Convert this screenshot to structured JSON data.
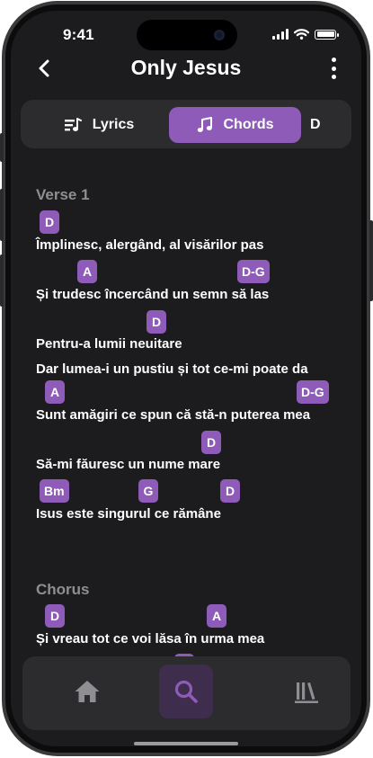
{
  "status_bar": {
    "time": "9:41"
  },
  "header": {
    "title": "Only Jesus"
  },
  "tabs": [
    {
      "label": "Lyrics",
      "icon": "lyrics-note-icon",
      "active": false
    },
    {
      "label": "Chords",
      "icon": "music-note-icon",
      "active": true
    },
    {
      "label": "D",
      "active": false
    }
  ],
  "colors": {
    "accent": "#8e5cb8",
    "background": "#1c1c1e",
    "surface": "#2c2c2e",
    "section_heading": "#8e8e93"
  },
  "song": {
    "sections": [
      {
        "title": "Verse 1",
        "lines": [
          {
            "text": " Împlinesc, alergând, al visărilor pas",
            "chords": [
              "D"
            ]
          },
          {
            "text": "Și trudesc încercând un semn să las",
            "chords": [
              "A",
              "D-G"
            ]
          },
          {
            "text": "Pentru-a lumii neuitare",
            "chords": [
              "D"
            ]
          },
          {
            "text": "Dar lumea-i un pustiu și tot ce-mi poate da",
            "chords": []
          },
          {
            "text": "Sunt amăgiri ce spun că stă-n puterea mea",
            "chords": [
              "A",
              "D-G"
            ]
          },
          {
            "text": "Să-mi făuresc un nume mare",
            "chords": [
              "D"
            ]
          },
          {
            "text": "Isus este singurul ce rămâne",
            "chords": [
              "Bm",
              "G",
              "D"
            ]
          }
        ]
      },
      {
        "title": "Chorus",
        "lines": [
          {
            "text": "Și vreau tot ce voi lăsa în urma mea",
            "chords": [
              "D",
              "A"
            ]
          },
          {
            "text": "",
            "chords": [
              "G"
            ]
          }
        ]
      }
    ]
  },
  "bottom_nav": [
    {
      "name": "home",
      "icon": "home-icon",
      "active": false
    },
    {
      "name": "search",
      "icon": "search-icon",
      "active": true
    },
    {
      "name": "library",
      "icon": "library-icon",
      "active": false
    }
  ]
}
